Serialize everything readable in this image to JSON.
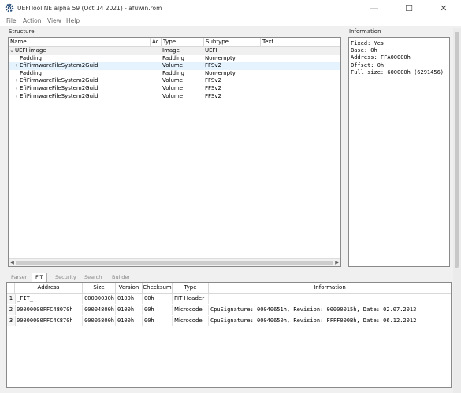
{
  "window": {
    "title": "UEFITool NE alpha 59 (Oct 14 2021) - afuwin.rom",
    "minimize": "—",
    "maximize": "☐",
    "close": "✕"
  },
  "menu": [
    "File",
    "Action",
    "View",
    "Help"
  ],
  "structure": {
    "label": "Structure",
    "columns": [
      "Name",
      "Ac",
      "Type",
      "Subtype",
      "Text"
    ],
    "rows": [
      {
        "caret": "⌄",
        "name": "UEFI image",
        "type": "Image",
        "subtype": "UEFI"
      },
      {
        "caret": "",
        "name": "Padding",
        "type": "Padding",
        "subtype": "Non-empty"
      },
      {
        "caret": "›",
        "name": "EfiFirmwareFileSystem2Guid",
        "type": "Volume",
        "subtype": "FFSv2"
      },
      {
        "caret": "",
        "name": "Padding",
        "type": "Padding",
        "subtype": "Non-empty"
      },
      {
        "caret": "›",
        "name": "EfiFirmwareFileSystem2Guid",
        "type": "Volume",
        "subtype": "FFSv2"
      },
      {
        "caret": "›",
        "name": "EfiFirmwareFileSystem2Guid",
        "type": "Volume",
        "subtype": "FFSv2"
      },
      {
        "caret": "›",
        "name": "EfiFirmwareFileSystem2Guid",
        "type": "Volume",
        "subtype": "FFSv2"
      }
    ]
  },
  "information": {
    "label": "Information",
    "lines": [
      "Fixed: Yes",
      "Base: 0h",
      "Address: FFA00000h",
      "Offset: 0h",
      "Full size: 600000h (6291456)"
    ]
  },
  "tabs": [
    "Parser",
    "FIT",
    "Security",
    "Search",
    "Builder"
  ],
  "active_tab": "FIT",
  "fit": {
    "columns": [
      "Address",
      "Size",
      "Version",
      "Checksum",
      "Type",
      "Information"
    ],
    "rows": [
      {
        "num": "1",
        "address": "_FIT_",
        "size": "00000030h",
        "version": "0100h",
        "checksum": "00h",
        "type": "FIT Header",
        "info": ""
      },
      {
        "num": "2",
        "address": "00000000FFC48070h",
        "size": "00004800h",
        "version": "0100h",
        "checksum": "00h",
        "type": "Microcode",
        "info": "CpuSignature: 00040651h, Revision: 00000015h, Date: 02.07.2013"
      },
      {
        "num": "3",
        "address": "00000000FFC4C870h",
        "size": "00005800h",
        "version": "0100h",
        "checksum": "00h",
        "type": "Microcode",
        "info": "CpuSignature: 00040650h, Revision: FFFF000Bh, Date: 06.12.2012"
      }
    ]
  },
  "colors": {
    "selected_row": "#cce8ff",
    "hover_row": "#e5f3ff"
  }
}
